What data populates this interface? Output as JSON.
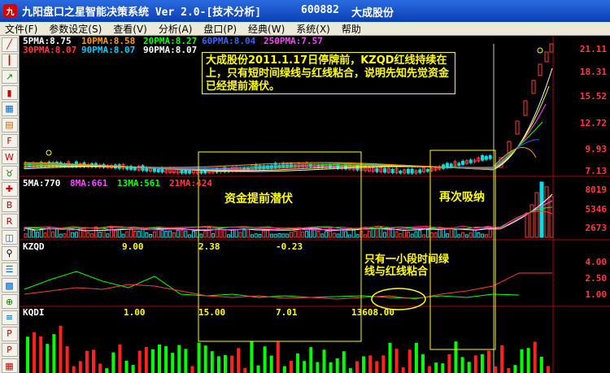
{
  "window": {
    "icon_text": "九",
    "title": "九阳盘口之星智能决策系统 Ver 2.0-[技术分析]",
    "stock_code": "600882",
    "stock_name": "大成股份"
  },
  "menu": [
    "文件(F)",
    "参数设定(S)",
    "查看(V)",
    "分析(A)",
    "盘口(P)",
    "经典(W)",
    "系统(X)",
    "帮助"
  ],
  "toolbar_icons": [
    "line-chart-icon",
    "candle-chart-icon",
    "trend-icon",
    "bar-icon",
    "multi-window-icon",
    "stats-icon",
    "f10-icon",
    "w-icon",
    "bull-icon",
    "cross-icon",
    "b-icon",
    "r-icon",
    "chart-small-icon",
    "bike-icon",
    "list-icon",
    "grid-icon",
    "magnify-icon",
    "menu-icon",
    "pak-icon",
    "pak2-icon",
    "grid2-icon"
  ],
  "price_panel": {
    "ma_labels": [
      {
        "text": "5PMA:8.75",
        "color": "#ffffff"
      },
      {
        "text": "10PMA:8.58",
        "color": "#ff9900"
      },
      {
        "text": "20PMA:8.27",
        "color": "#00ff00"
      },
      {
        "text": "60PMA:8.04",
        "color": "#3366ff"
      },
      {
        "text": "250PMA:7.57",
        "color": "#ff44ff"
      }
    ],
    "ma_labels_row2": [
      {
        "text": "30PMA:8.07",
        "color": "#ff3b3b"
      },
      {
        "text": "90PMA:8.07",
        "color": "#00ccff"
      },
      {
        "text": "90PMA:8.07",
        "color": "#ffffff"
      }
    ],
    "axis": [
      "21.11",
      "18.31",
      "15.52",
      "12.72",
      "9.93",
      "7.13"
    ]
  },
  "volume_panel": {
    "labels": [
      {
        "text": "5MA:770",
        "color": "#ffffff"
      },
      {
        "text": "8MA:661",
        "color": "#ff44ff"
      },
      {
        "text": "13MA:561",
        "color": "#00ff00"
      },
      {
        "text": "21MA:424",
        "color": "#ff3b3b"
      }
    ],
    "axis": [
      "8019",
      "5346",
      "2673"
    ]
  },
  "kzqd_panel": {
    "label": "KZQD",
    "values": [
      "9.00",
      "2.38",
      "-0.23"
    ],
    "axis": [
      "4.00",
      "2.50",
      "1.00"
    ]
  },
  "kqdi_panel": {
    "label": "KQDI",
    "values": [
      "1.00",
      "15.00",
      "7.01",
      "13608.00"
    ]
  },
  "annotations": {
    "note": "大成股份2011.1.17日停牌前，KZQD红线持续在上，只有短时间绿线与红线粘合，说明先知先觉资金已经提前潜伏。",
    "capital": "资金提前潜伏",
    "absorb": "再次吸纳",
    "short": "只有一小段时间绿线与红线粘合"
  }
}
